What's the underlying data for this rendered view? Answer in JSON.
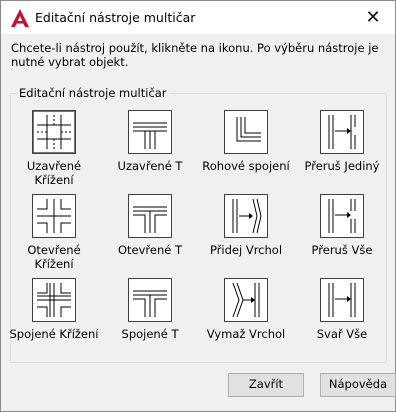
{
  "window": {
    "title": "Editační nástroje multičar",
    "close_glyph": "✕"
  },
  "description": "Chcete-li nástroj použít, klikněte na ikonu. Po výběru nástroje je nutné vybrat objekt.",
  "group_label": "Editační nástroje multičar",
  "tools": [
    {
      "label": "Uzavřené Křížení",
      "icon": "closed-cross-icon"
    },
    {
      "label": "Uzavřené T",
      "icon": "closed-tee-icon"
    },
    {
      "label": "Rohové spojení",
      "icon": "corner-joint-icon"
    },
    {
      "label": "Přeruš Jediný",
      "icon": "cut-single-icon"
    },
    {
      "label": "Otevřené Křížení",
      "icon": "open-cross-icon"
    },
    {
      "label": "Otevřené T",
      "icon": "open-tee-icon"
    },
    {
      "label": "Přidej Vrchol",
      "icon": "add-vertex-icon"
    },
    {
      "label": "Přeruš Vše",
      "icon": "cut-all-icon"
    },
    {
      "label": "Spojené Křížení",
      "icon": "merged-cross-icon"
    },
    {
      "label": "Spojené T",
      "icon": "merged-tee-icon"
    },
    {
      "label": "Vymaž Vrchol",
      "icon": "delete-vertex-icon"
    },
    {
      "label": "Svař Vše",
      "icon": "weld-all-icon"
    }
  ],
  "buttons": {
    "close": "Zavřít",
    "help": "Nápověda"
  }
}
